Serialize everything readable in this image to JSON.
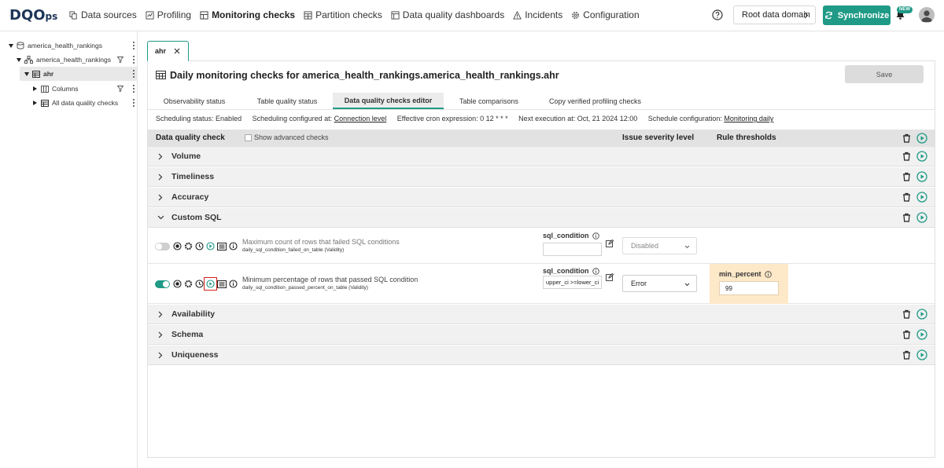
{
  "app": {
    "logo": "DQO",
    "logo_suffix": "ps"
  },
  "nav": {
    "items": [
      {
        "label": "Data sources",
        "icon": "data-sources-icon"
      },
      {
        "label": "Profiling",
        "icon": "profiling-icon"
      },
      {
        "label": "Monitoring checks",
        "icon": "monitoring-icon",
        "active": true
      },
      {
        "label": "Partition checks",
        "icon": "partition-icon"
      },
      {
        "label": "Data quality dashboards",
        "icon": "dashboard-icon"
      },
      {
        "label": "Incidents",
        "icon": "warning-icon"
      },
      {
        "label": "Configuration",
        "icon": "gear-icon"
      }
    ],
    "domain_button": "Root data domain",
    "sync_button": "Synchronize",
    "new_badge": "NEW"
  },
  "tree": {
    "items": [
      {
        "label": "america_health_rankings",
        "level": 0,
        "icon": "database-icon"
      },
      {
        "label": "america_health_rankings",
        "level": 1,
        "icon": "schema-icon"
      },
      {
        "label": "ahr",
        "level": 2,
        "icon": "table-icon",
        "selected": true
      },
      {
        "label": "Columns",
        "level": 3,
        "icon": "columns-icon"
      },
      {
        "label": "All data quality checks",
        "level": 3,
        "icon": "table-icon"
      }
    ]
  },
  "tab": {
    "label": "ahr"
  },
  "page": {
    "title": "Daily monitoring checks for america_health_rankings.america_health_rankings.ahr",
    "save": "Save",
    "subtabs": [
      "Observability status",
      "Table quality status",
      "Data quality checks editor",
      "Table comparisons",
      "Copy verified profiling checks"
    ],
    "active_subtab": "Data quality checks editor",
    "schedule": {
      "status": "Scheduling status: Enabled",
      "configured_prefix": "Scheduling configured at: ",
      "configured_link": "Connection level",
      "cron": "Effective cron expression: 0 12 * * *",
      "next": "Next execution at: Oct, 21 2024 12:00",
      "config_prefix": "Schedule configuration: ",
      "config_link": "Monitoring daily"
    }
  },
  "grid": {
    "headers": {
      "check": "Data quality check",
      "advanced": "Show advanced checks",
      "severity": "Issue severity level",
      "thresholds": "Rule thresholds"
    },
    "categories": [
      "Volume",
      "Timeliness",
      "Accuracy",
      "Custom SQL",
      "Availability",
      "Schema",
      "Uniqueness"
    ],
    "checks": [
      {
        "title": "Maximum count of rows that failed SQL conditions",
        "name": "daily_sql_condition_failed_on_table (Validity)",
        "enabled": false,
        "param_label": "sql_condition",
        "param_value": "",
        "severity": "Disabled"
      },
      {
        "title": "Minimum percentage of rows that passed SQL condition",
        "name": "daily_sql_condition_passed_percent_on_table (Validity)",
        "enabled": true,
        "param_label": "sql_condition",
        "param_value": "upper_ci >=lower_ci",
        "severity": "Error",
        "threshold_label": "min_percent",
        "threshold_value": "99"
      }
    ]
  },
  "colors": {
    "accent": "#1f9a86",
    "threshold_bg": "#fde8c8",
    "highlight": "#d32020"
  }
}
